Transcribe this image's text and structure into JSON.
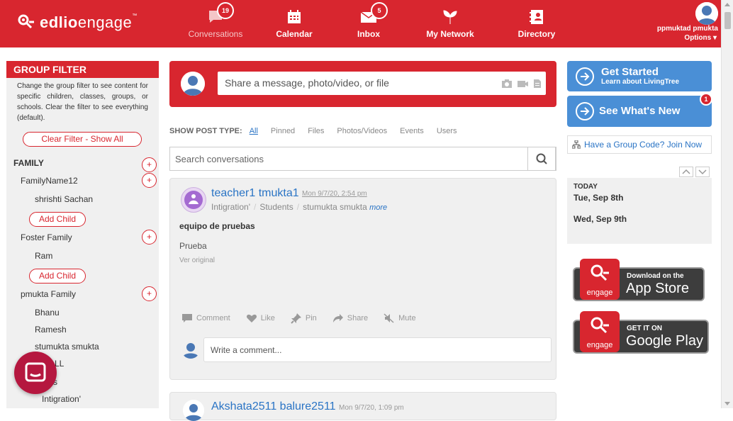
{
  "header": {
    "brand": "edlio",
    "brand2": "engage",
    "brand_tm": "™",
    "nav": [
      {
        "label": "Conversations",
        "badge": "19"
      },
      {
        "label": "Calendar"
      },
      {
        "label": "Inbox",
        "badge": "5"
      },
      {
        "label": "My Network"
      },
      {
        "label": "Directory"
      }
    ],
    "user_name": "ppmuktad pmukta",
    "options_label": "Options ▾"
  },
  "sidebar": {
    "title": "GROUP FILTER",
    "description": "Change the group filter to see content for specific children, classes, groups, or schools. Clear the filter to see everything (default).",
    "clear_button": "Clear Filter - Show All",
    "family_heading": "FAMILY",
    "family1": "FamilyName12",
    "member1": "shrishti Sachan",
    "add_child": "Add Child",
    "family2": "Foster Family",
    "member2": "Ram",
    "family3": "pmukta Family",
    "member3": "Bhanu",
    "member4": "Ramesh",
    "member5": "stumukta smukta",
    "all_label": "ALL",
    "class_label": "ss",
    "class2": "Intigration'",
    "plus": "+"
  },
  "composer": {
    "placeholder": "Share a message, photo/video, or file"
  },
  "post_type": {
    "label": "SHOW POST TYPE:",
    "options": [
      "All",
      "Pinned",
      "Files",
      "Photos/Videos",
      "Events",
      "Users"
    ]
  },
  "search": {
    "placeholder": "Search conversations"
  },
  "post": {
    "author": "teacher1 tmukta1",
    "date": "Mon 9/7/20, 2:54 pm",
    "group": "Intigration'",
    "audience": "Students",
    "student": "stumukta smukta",
    "more": "more",
    "title": "equipo de pruebas",
    "body": "Prueba",
    "original": "Ver original",
    "actions": [
      "Comment",
      "Like",
      "Pin",
      "Share",
      "Mute"
    ],
    "comment_placeholder": "Write a comment..."
  },
  "post2": {
    "author": "Akshata2511 balure2511",
    "date": "Mon 9/7/20, 1:09 pm"
  },
  "right": {
    "get_started": "Get Started",
    "get_started_sub": "Learn about LivingTree",
    "whats_new": "See What's New",
    "whats_new_badge": "1",
    "group_code": "Have a Group Code? Join Now",
    "today": "TODAY",
    "day1": "Tue, Sep 8th",
    "day2": "Wed, Sep 9th",
    "app_store_small": "Download on the",
    "app_store_big": "App Store",
    "play_small": "GET IT ON",
    "play_big": "Google Play",
    "engage_label": "engage"
  },
  "colors": {
    "brand_red": "#d8262f",
    "link_blue": "#2a74c5",
    "button_blue": "#4a8fd6"
  }
}
